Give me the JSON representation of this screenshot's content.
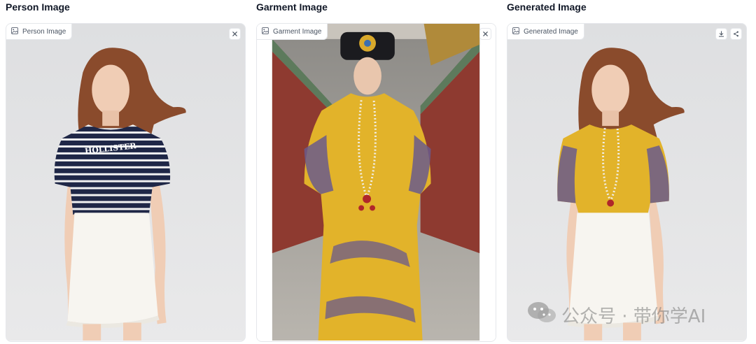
{
  "columns": [
    {
      "title": "Person Image",
      "chip": "Person Image"
    },
    {
      "title": "Garment Image",
      "chip": "Garment Image"
    },
    {
      "title": "Generated Image",
      "chip": "Generated Image"
    }
  ],
  "shirt_print": "HOLLISTER",
  "watermark": "公众号 · 带你学AI",
  "icons": {
    "chip": "image-icon",
    "clear": "close-icon",
    "download": "download-icon",
    "share": "share-icon",
    "watermark": "wechat-icon"
  },
  "colors": {
    "panel_border": "#e5e7eb",
    "panel_bg": "#f3f4f6",
    "title": "#111827",
    "garment_yellow": "#e2b32a",
    "shirt_navy": "#1f2747"
  }
}
